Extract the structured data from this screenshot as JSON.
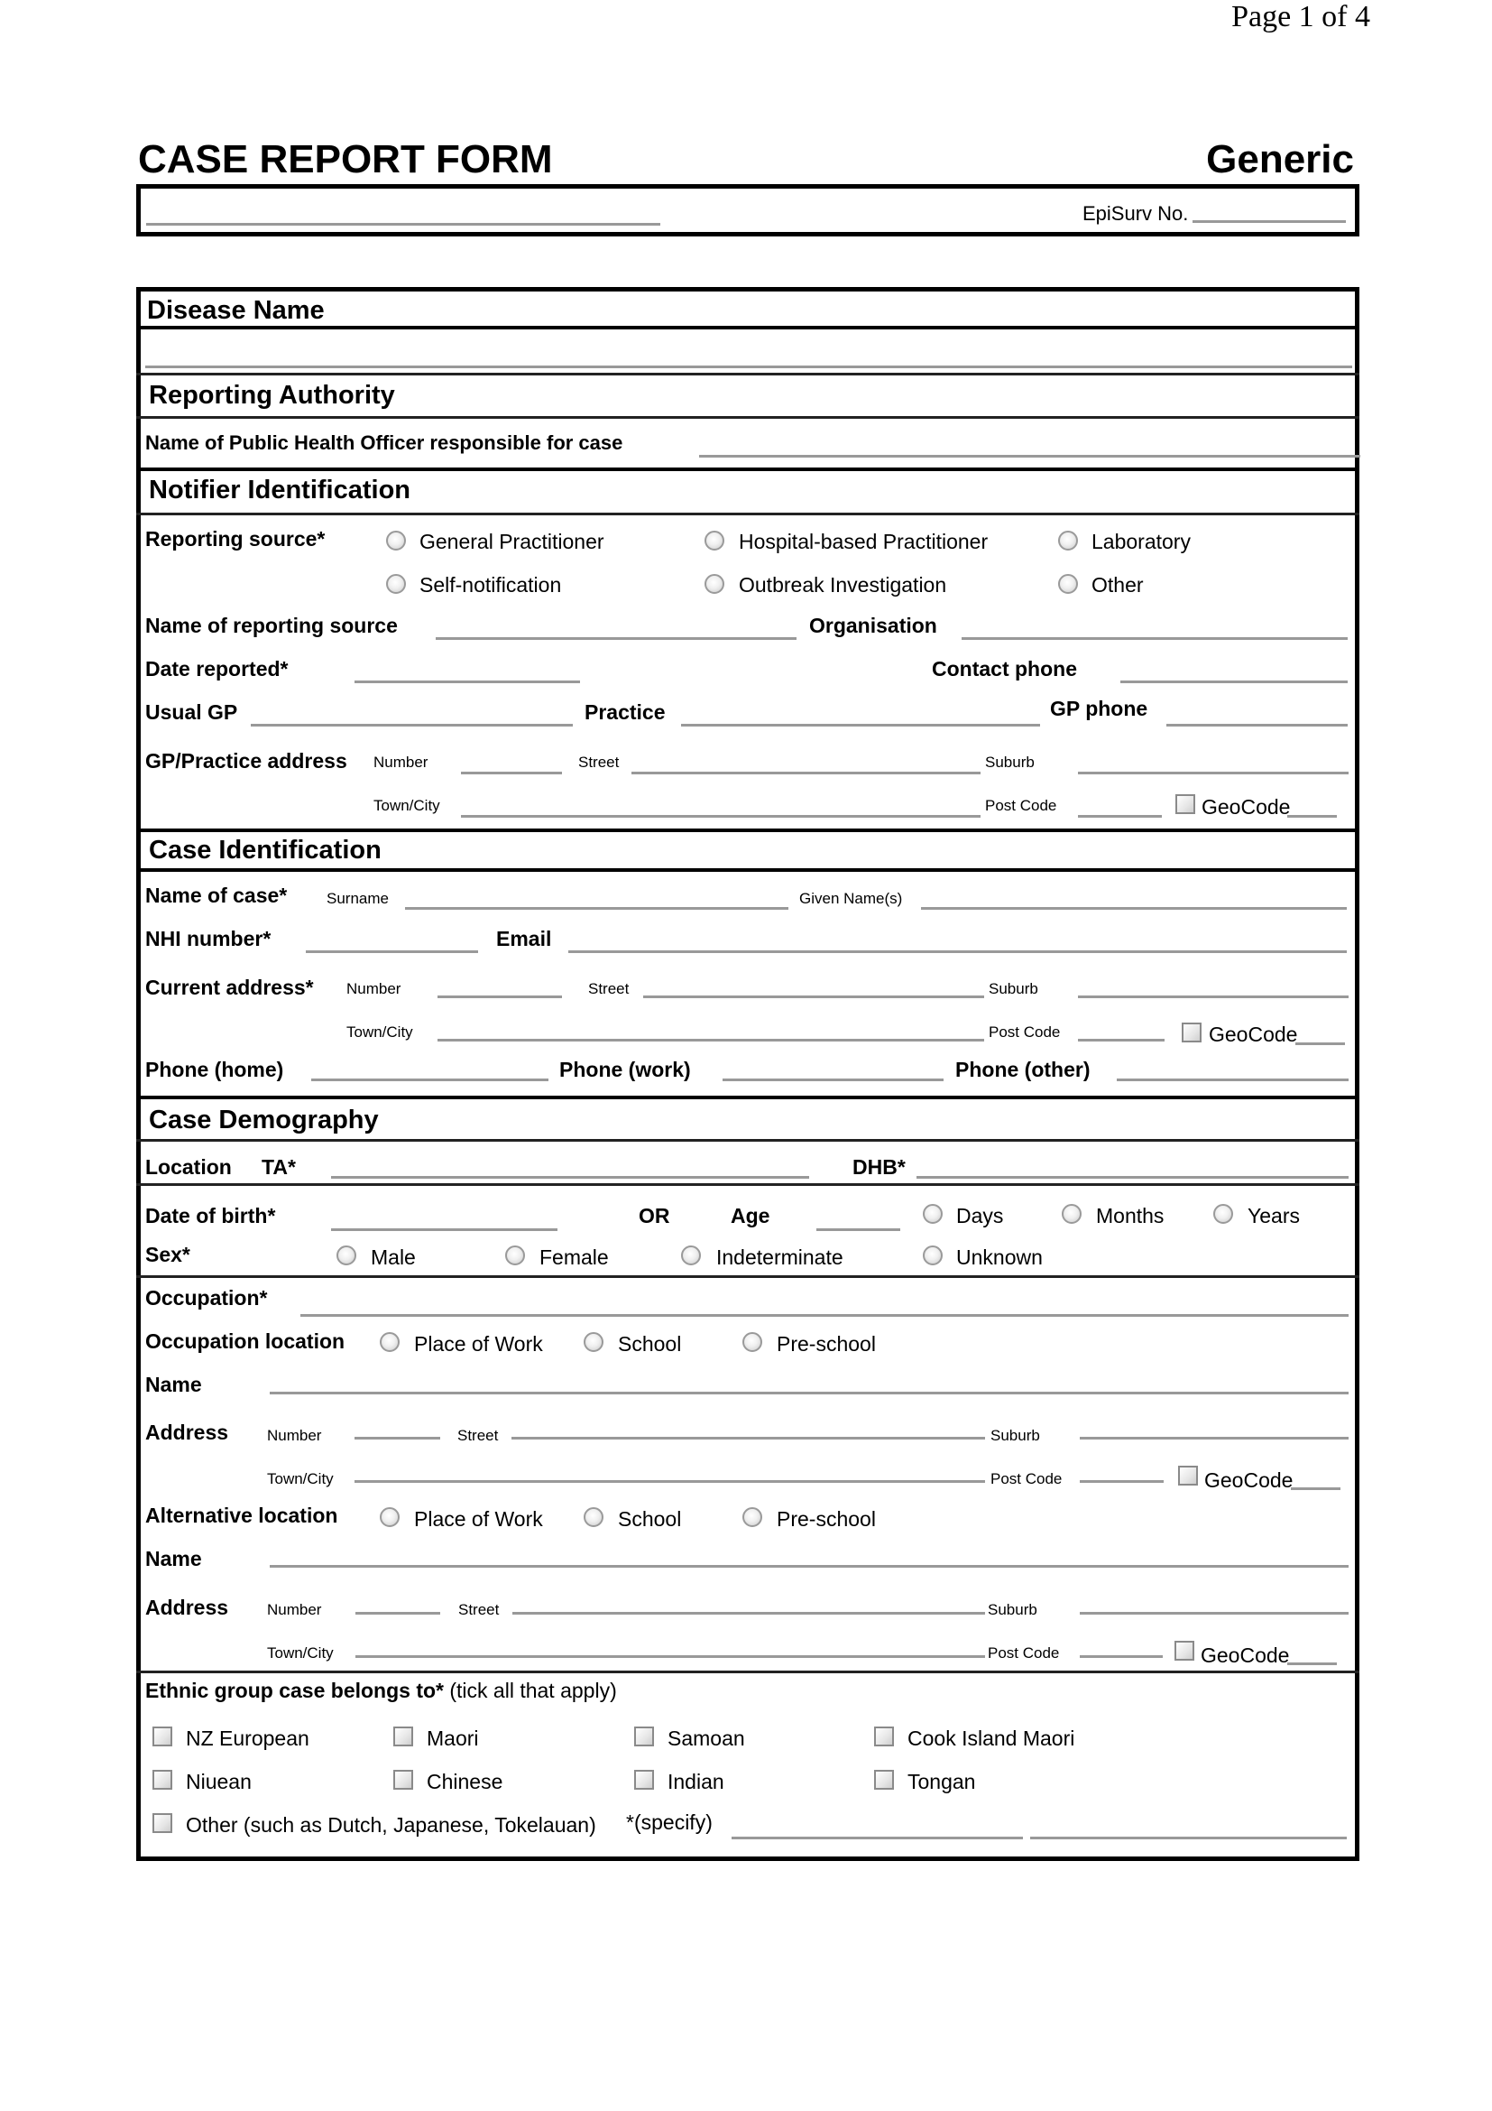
{
  "page": {
    "indicator": "Page 1 of 4"
  },
  "header": {
    "title": "CASE REPORT FORM",
    "subtitle": "Generic",
    "episurv_label": "EpiSurv No."
  },
  "disease": {
    "heading": "Disease Name"
  },
  "reporting_authority": {
    "heading": "Reporting Authority",
    "officer_label": "Name of Public Health Officer responsible for case"
  },
  "notifier": {
    "heading": "Notifier Identification",
    "reporting_source_label": "Reporting source*",
    "reporting_source_options": [
      "General Practitioner",
      "Hospital-based Practitioner",
      "Laboratory",
      "Self-notification",
      "Outbreak Investigation",
      "Other"
    ],
    "name_label": "Name of reporting source",
    "organisation_label": "Organisation",
    "date_label": "Date reported*",
    "contact_phone_label": "Contact phone",
    "usual_gp_label": "Usual GP",
    "practice_label": "Practice",
    "gp_phone_label": "GP phone",
    "address_label": "GP/Practice address"
  },
  "address_fields": {
    "number": "Number",
    "street": "Street",
    "suburb": "Suburb",
    "town": "Town/City",
    "postcode": "Post Code",
    "geocode": "GeoCode"
  },
  "case_identification": {
    "heading": "Case Identification",
    "name_label": "Name of case*",
    "surname_label": "Surname",
    "given_label": "Given Name(s)",
    "nhi_label": "NHI number*",
    "email_label": "Email",
    "address_label": "Current address*",
    "phone_home_label": "Phone (home)",
    "phone_work_label": "Phone (work)",
    "phone_other_label": "Phone (other)"
  },
  "demography": {
    "heading": "Case Demography",
    "location_label": "Location",
    "ta_label": "TA*",
    "dhb_label": "DHB*",
    "dob_label": "Date of birth*",
    "or_label": "OR",
    "age_label": "Age",
    "age_units": [
      "Days",
      "Months",
      "Years"
    ],
    "sex_label": "Sex*",
    "sex_options": [
      "Male",
      "Female",
      "Indeterminate",
      "Unknown"
    ],
    "occupation_label": "Occupation*",
    "occ_location_label": "Occupation location",
    "alt_location_label": "Alternative location",
    "location_options": [
      "Place of Work",
      "School",
      "Pre-school"
    ],
    "name_label": "Name",
    "address_label": "Address"
  },
  "ethnicity": {
    "label_bold": "Ethnic group case belongs to*",
    "label_note": "(tick all that apply)",
    "options": [
      "NZ European",
      "Maori",
      "Samoan",
      "Cook Island Maori",
      "Niuean",
      "Chinese",
      "Indian",
      "Tongan"
    ],
    "other_label": "Other (such as Dutch, Japanese, Tokelauan)",
    "specify_label": "*(specify)"
  }
}
